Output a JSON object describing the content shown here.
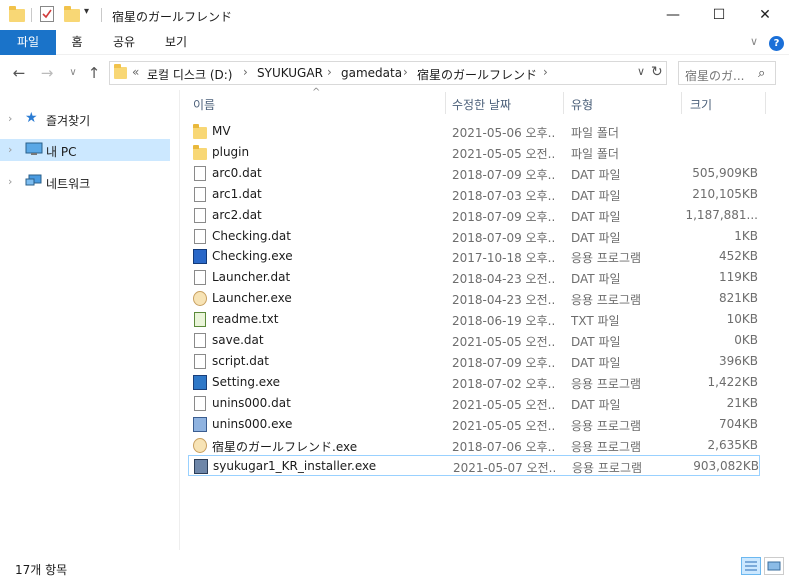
{
  "window": {
    "title": "宿星のガールフレンド",
    "minimize": "—",
    "maximize": "☐",
    "close": "✕"
  },
  "ribbon": {
    "tabs": [
      "파일",
      "홈",
      "공유",
      "보기"
    ],
    "collapse": "∨",
    "help": "?"
  },
  "nav": {
    "back": "←",
    "forward": "→",
    "recent": "∨",
    "up": "↑",
    "overflow": "«",
    "breadcrumbs": [
      "로컬 디스크 (D:)",
      "SYUKUGAR",
      "gamedata",
      "宿星のガールフレンド"
    ],
    "separator": "›",
    "dropdown": "∨",
    "refresh": "↻",
    "search_placeholder": "宿星のガ..."
  },
  "sidebar": {
    "items": [
      {
        "label": "즐겨찾기",
        "icon": "star-icon",
        "selected": false
      },
      {
        "label": "내 PC",
        "icon": "computer-icon",
        "selected": true
      },
      {
        "label": "네트워크",
        "icon": "network-icon",
        "selected": false
      }
    ],
    "chevron": "›"
  },
  "columns": {
    "name": "이름",
    "date": "수정한 날짜",
    "type": "유형",
    "size": "크기",
    "sort_indicator": "^"
  },
  "files": [
    {
      "name": "MV",
      "date": "2021-05-06 오후...",
      "type": "파일 폴더",
      "size": "",
      "icon": "folder-icon"
    },
    {
      "name": "plugin",
      "date": "2021-05-05 오전...",
      "type": "파일 폴더",
      "size": "",
      "icon": "folder-icon"
    },
    {
      "name": "arc0.dat",
      "date": "2018-07-09 오후...",
      "type": "DAT 파일",
      "size": "505,909KB",
      "icon": "file-icon"
    },
    {
      "name": "arc1.dat",
      "date": "2018-07-03 오후...",
      "type": "DAT 파일",
      "size": "210,105KB",
      "icon": "file-icon"
    },
    {
      "name": "arc2.dat",
      "date": "2018-07-09 오후...",
      "type": "DAT 파일",
      "size": "1,187,881...",
      "icon": "file-icon"
    },
    {
      "name": "Checking.dat",
      "date": "2018-07-09 오후...",
      "type": "DAT 파일",
      "size": "1KB",
      "icon": "file-icon"
    },
    {
      "name": "Checking.exe",
      "date": "2017-10-18 오후...",
      "type": "응용 프로그램",
      "size": "452KB",
      "icon": "exe-blue-icon"
    },
    {
      "name": "Launcher.dat",
      "date": "2018-04-23 오전...",
      "type": "DAT 파일",
      "size": "119KB",
      "icon": "file-icon"
    },
    {
      "name": "Launcher.exe",
      "date": "2018-04-23 오전...",
      "type": "응용 프로그램",
      "size": "821KB",
      "icon": "character-app-icon"
    },
    {
      "name": "readme.txt",
      "date": "2018-06-19 오후...",
      "type": "TXT 파일",
      "size": "10KB",
      "icon": "text-file-icon"
    },
    {
      "name": "save.dat",
      "date": "2021-05-05 오전...",
      "type": "DAT 파일",
      "size": "0KB",
      "icon": "file-icon"
    },
    {
      "name": "script.dat",
      "date": "2018-07-09 오후...",
      "type": "DAT 파일",
      "size": "396KB",
      "icon": "file-icon"
    },
    {
      "name": "Setting.exe",
      "date": "2018-07-02 오후...",
      "type": "응용 프로그램",
      "size": "1,422KB",
      "icon": "settings-app-icon"
    },
    {
      "name": "unins000.dat",
      "date": "2021-05-05 오전...",
      "type": "DAT 파일",
      "size": "21KB",
      "icon": "file-icon"
    },
    {
      "name": "unins000.exe",
      "date": "2021-05-05 오전...",
      "type": "응용 프로그램",
      "size": "704KB",
      "icon": "uninstaller-icon"
    },
    {
      "name": "宿星のガールフレンド.exe",
      "date": "2018-07-06 오후...",
      "type": "응용 프로그램",
      "size": "2,635KB",
      "icon": "character-app-icon"
    },
    {
      "name": "syukugar1_KR_installer.exe",
      "date": "2021-05-07 오전...",
      "type": "응용 프로그램",
      "size": "903,082KB",
      "icon": "installer-icon"
    }
  ],
  "status": {
    "item_count": "17개 항목"
  }
}
